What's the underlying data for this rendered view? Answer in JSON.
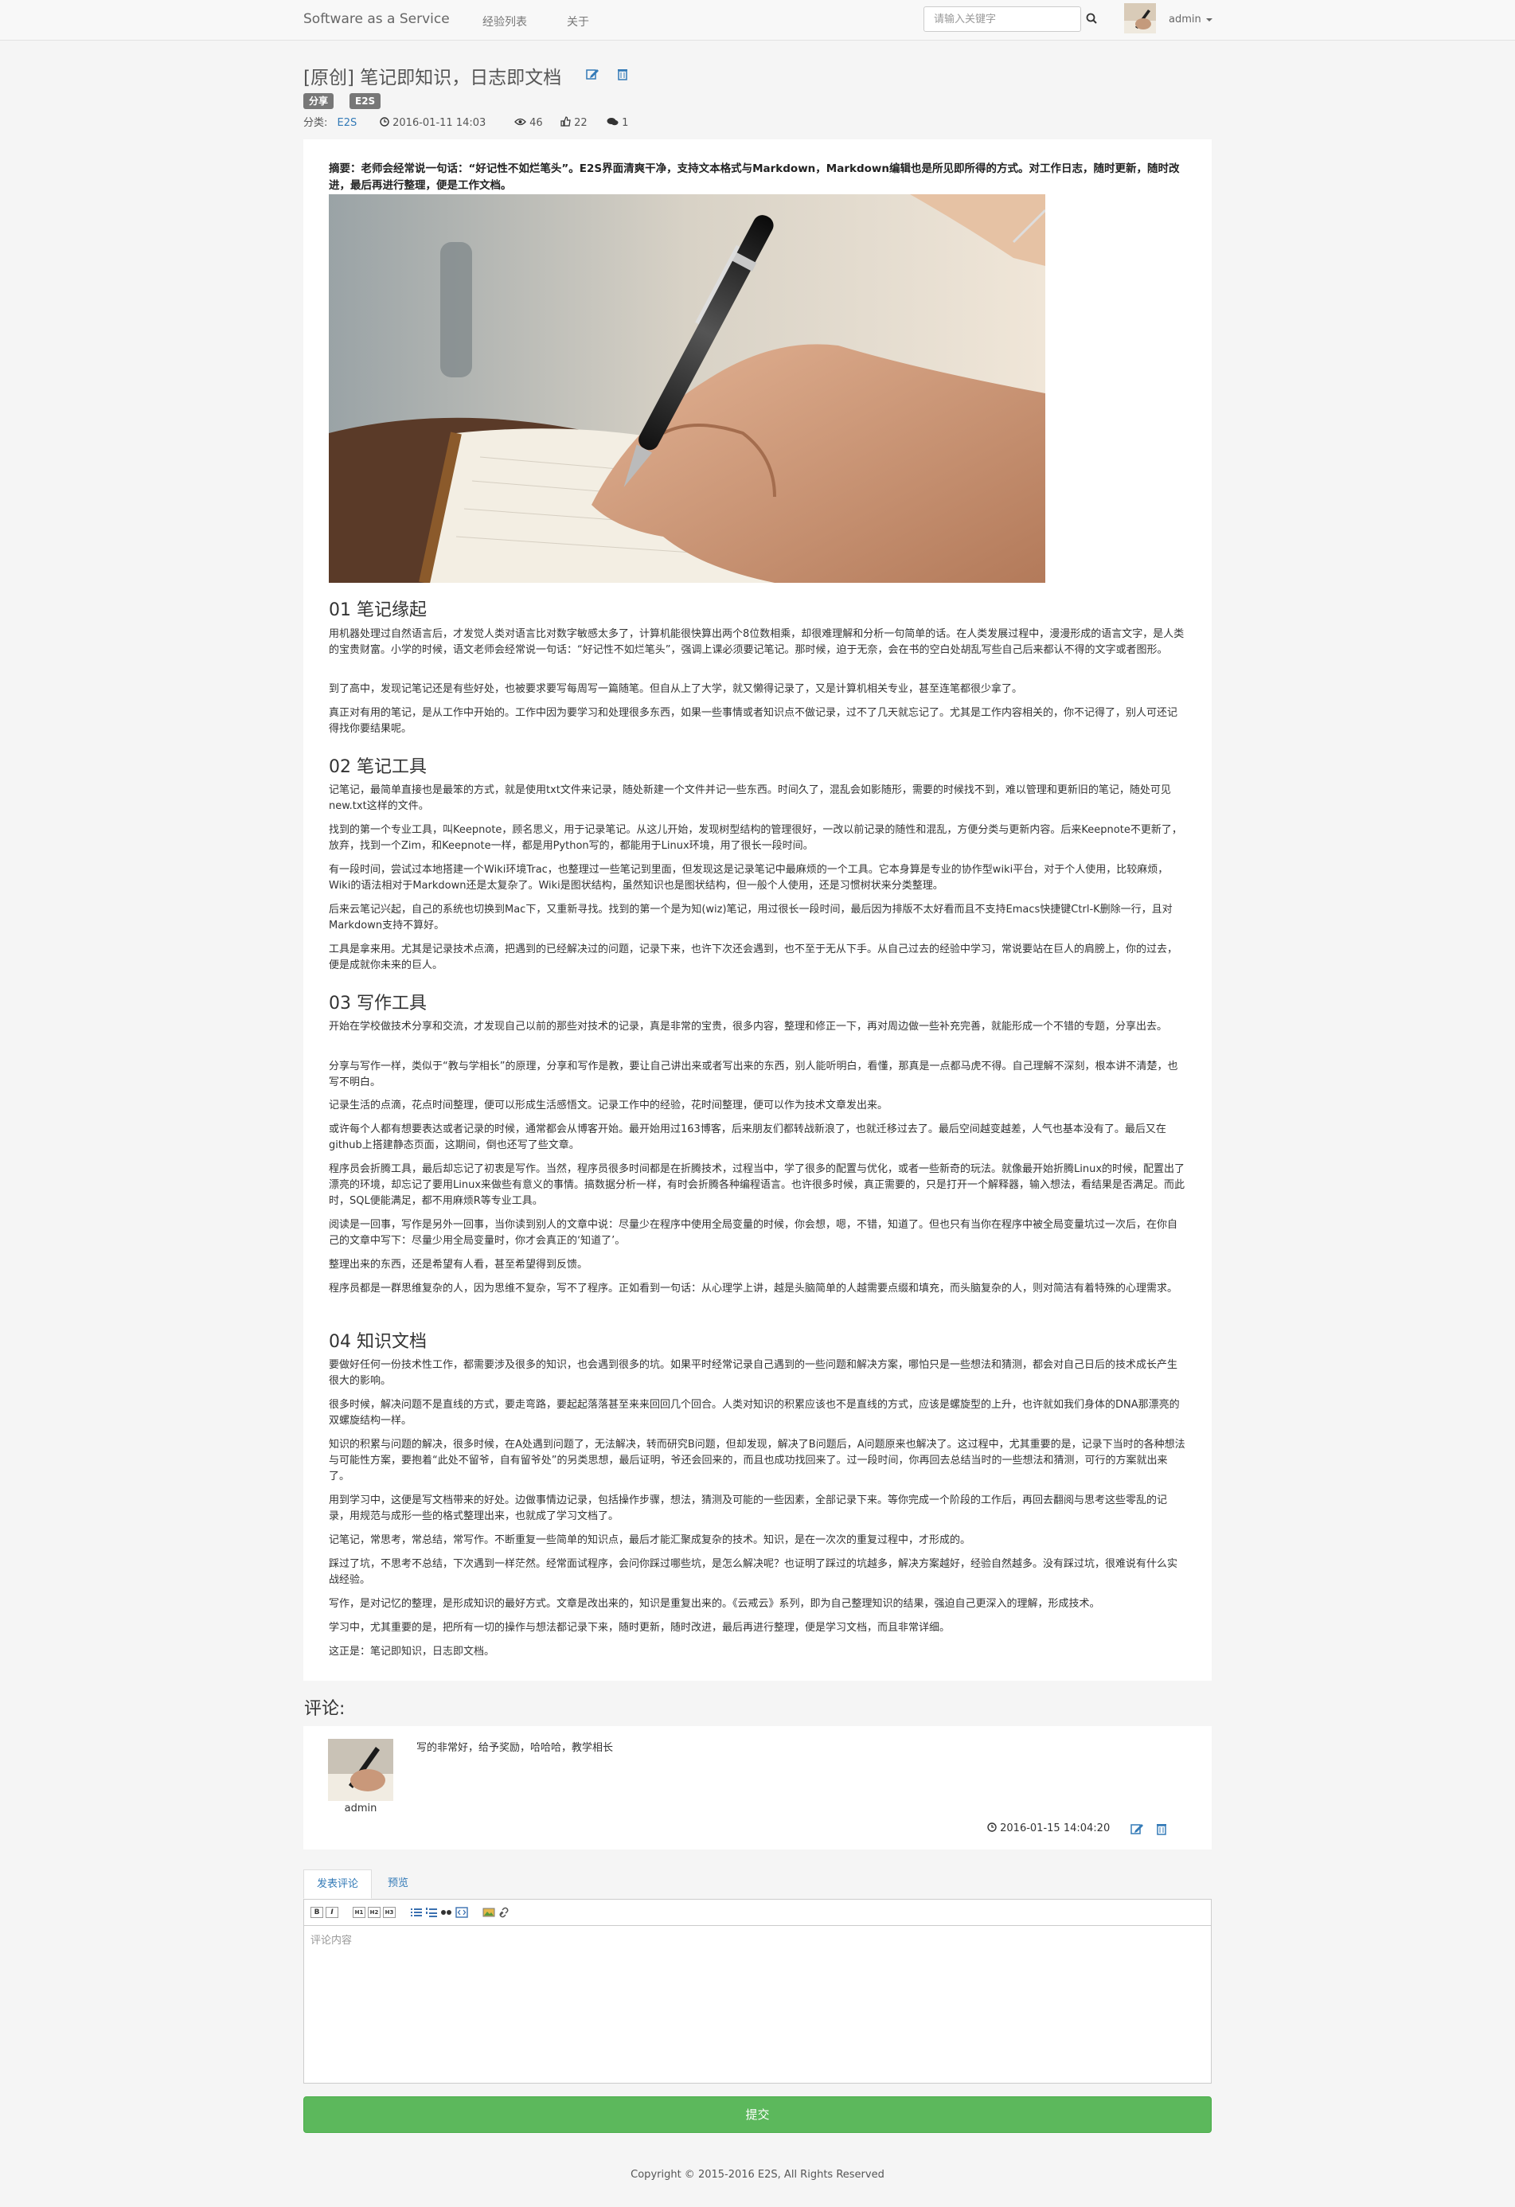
{
  "nav": {
    "brand": "Software as a Service",
    "links": [
      "经验列表",
      "关于"
    ],
    "search_placeholder": "请输入关键字",
    "user": "admin"
  },
  "post": {
    "title": "[原创] 笔记即知识，日志即文档",
    "tags": [
      "分享",
      "E2S"
    ],
    "meta": {
      "category_label": "分类:",
      "category": "E2S",
      "date": "2016-01-11 14:03",
      "views": "46",
      "likes": "22",
      "comments": "1"
    },
    "summary": "摘要：老师会经常说一句话：“好记性不如烂笔头”。E2S界面清爽干净，支持文本格式与Markdown，Markdown编辑也是所见即所得的方式。对工作日志，随时更新，随时改进，最后再进行整理，便是工作文档。",
    "image": "hand-writing-notebook-photo",
    "sections": [
      {
        "heading": "01 笔记缘起",
        "paragraphs": [
          "用机器处理过自然语言后，才发觉人类对语言比对数字敏感太多了，计算机能很快算出两个8位数相乘，却很难理解和分析一句简单的话。在人类发展过程中，漫漫形成的语言文字，是人类的宝贵财富。小学的时候，语文老师会经常说一句话：“好记性不如烂笔头”，强调上课必须要记笔记。那时候，迫于无奈，会在书的空白处胡乱写些自己后来都认不得的文字或者图形。",
          "到了高中，发现记笔记还是有些好处，也被要求要写每周写一篇随笔。但自从上了大学，就又懒得记录了，又是计算机相关专业，甚至连笔都很少拿了。",
          "真正对有用的笔记，是从工作中开始的。工作中因为要学习和处理很多东西，如果一些事情或者知识点不做记录，过不了几天就忘记了。尤其是工作内容相关的，你不记得了，别人可还记得找你要结果呢。"
        ]
      },
      {
        "heading": "02 笔记工具",
        "paragraphs": [
          "记笔记，最简单直接也是最笨的方式，就是使用txt文件来记录，随处新建一个文件并记一些东西。时间久了，混乱会如影随形，需要的时候找不到，难以管理和更新旧的笔记，随处可见new.txt这样的文件。",
          "找到的第一个专业工具，叫Keepnote，顾名思义，用于记录笔记。从这儿开始，发现树型结构的管理很好，一改以前记录的随性和混乱，方便分类与更新内容。后来Keepnote不更新了，放弃，找到一个Zim，和Keepnote一样，都是用Python写的，都能用于Linux环境，用了很长一段时间。",
          "有一段时间，尝试过本地搭建一个Wiki环境Trac，也整理过一些笔记到里面，但发现这是记录笔记中最麻烦的一个工具。它本身算是专业的协作型wiki平台，对于个人使用，比较麻烦，Wiki的语法相对于Markdown还是太复杂了。Wiki是图状结构，虽然知识也是图状结构，但一般个人使用，还是习惯树状来分类整理。",
          "后来云笔记兴起，自己的系统也切换到Mac下，又重新寻找。找到的第一个是为知(wiz)笔记，用过很长一段时间，最后因为排版不太好看而且不支持Emacs快捷键Ctrl-K删除一行，且对Markdown支持不算好。",
          "工具是拿来用。尤其是记录技术点滴，把遇到的已经解决过的问题，记录下来，也许下次还会遇到，也不至于无从下手。从自己过去的经验中学习，常说要站在巨人的肩膀上，你的过去，便是成就你未来的巨人。"
        ]
      },
      {
        "heading": "03 写作工具",
        "paragraphs": [
          "开始在学校做技术分享和交流，才发现自己以前的那些对技术的记录，真是非常的宝贵，很多内容，整理和修正一下，再对周边做一些补充完善，就能形成一个不错的专题，分享出去。",
          "分享与写作一样，类似于“教与学相长”的原理，分享和写作是教，要让自己讲出来或者写出来的东西，别人能听明白，看懂，那真是一点都马虎不得。自己理解不深刻，根本讲不清楚，也写不明白。",
          "记录生活的点滴，花点时间整理，便可以形成生活感悟文。记录工作中的经验，花时间整理，便可以作为技术文章发出来。",
          "或许每个人都有想要表达或者记录的时候，通常都会从博客开始。最开始用过163博客，后来朋友们都转战新浪了，也就迁移过去了。最后空间越变越差，人气也基本没有了。最后又在github上搭建静态页面，这期间，倒也还写了些文章。",
          "程序员会折腾工具，最后却忘记了初衷是写作。当然，程序员很多时间都是在折腾技术，过程当中，学了很多的配置与优化，或者一些新奇的玩法。就像最开始折腾Linux的时候，配置出了漂亮的环境，却忘记了要用Linux来做些有意义的事情。搞数据分析一样，有时会折腾各种编程语言。也许很多时候，真正需要的，只是打开一个解释器，输入想法，看结果是否满足。而此时，SQL便能满足，都不用麻烦R等专业工具。",
          "阅读是一回事，写作是另外一回事，当你读到别人的文章中说：尽量少在程序中使用全局变量的时候，你会想，嗯，不错，知道了。但也只有当你在程序中被全局变量坑过一次后，在你自己的文章中写下：尽量少用全局变量时，你才会真正的‘知道了’。",
          "整理出来的东西，还是希望有人看，甚至希望得到反馈。",
          "程序员都是一群思维复杂的人，因为思维不复杂，写不了程序。正如看到一句话：从心理学上讲，越是头脑简单的人越需要点缀和填充，而头脑复杂的人，则对简洁有着特殊的心理需求。"
        ]
      },
      {
        "heading": "04 知识文档",
        "paragraphs": [
          "要做好任何一份技术性工作，都需要涉及很多的知识，也会遇到很多的坑。如果平时经常记录自己遇到的一些问题和解决方案，哪怕只是一些想法和猜测，都会对自己日后的技术成长产生很大的影响。",
          "很多时候，解决问题不是直线的方式，要走弯路，要起起落落甚至来来回回几个回合。人类对知识的积累应该也不是直线的方式，应该是螺旋型的上升，也许就如我们身体的DNA那漂亮的双螺旋结构一样。",
          "知识的积累与问题的解决，很多时候，在A处遇到问题了，无法解决，转而研究B问题，但却发现，解决了B问题后，A问题原来也解决了。这过程中，尤其重要的是，记录下当时的各种想法与可能性方案，要抱着“此处不留爷，自有留爷处”的另类思想，最后证明，爷还会回来的，而且也成功找回来了。过一段时间，你再回去总结当时的一些想法和猜测，可行的方案就出来了。",
          "用到学习中，这便是写文档带来的好处。边做事情边记录，包括操作步骤，想法，猜测及可能的一些因素，全部记录下来。等你完成一个阶段的工作后，再回去翻阅与思考这些零乱的记录，用规范与成形一些的格式整理出来，也就成了学习文档了。",
          "记笔记，常思考，常总结，常写作。不断重复一些简单的知识点，最后才能汇聚成复杂的技术。知识，是在一次次的重复过程中，才形成的。",
          "踩过了坑，不思考不总结，下次遇到一样茫然。经常面试程序，会问你踩过哪些坑，是怎么解决呢？也证明了踩过的坑越多，解决方案越好，经验自然越多。没有踩过坑，很难说有什么实战经验。",
          "写作，是对记忆的整理，是形成知识的最好方式。文章是改出来的，知识是重复出来的。《云戒云》系列，即为自己整理知识的结果，强迫自己更深入的理解，形成技术。",
          "学习中，尤其重要的是，把所有一切的操作与想法都记录下来，随时更新，随时改进，最后再进行整理，便是学习文档，而且非常详细。",
          "这正是：笔记即知识，日志即文档。"
        ]
      }
    ]
  },
  "comments": {
    "title": "评论:",
    "items": [
      {
        "user": "admin",
        "text": "写的非常好，给予奖励，哈哈哈，教学相长",
        "time": "2016-01-15 14:04:20"
      }
    ]
  },
  "editor": {
    "tabs": [
      "发表评论",
      "预览"
    ],
    "toolbar": [
      "B",
      "I",
      "H1",
      "H2",
      "H3",
      "ul",
      "ol",
      "quote",
      "code",
      "image",
      "link"
    ],
    "placeholder": "评论内容",
    "submit": "提交"
  },
  "footer": "Copyright © 2015-2016 E2S, All Rights Reserved",
  "colors": {
    "link": "#337ab7",
    "submit": "#5cb85c",
    "tag": "#777777"
  }
}
